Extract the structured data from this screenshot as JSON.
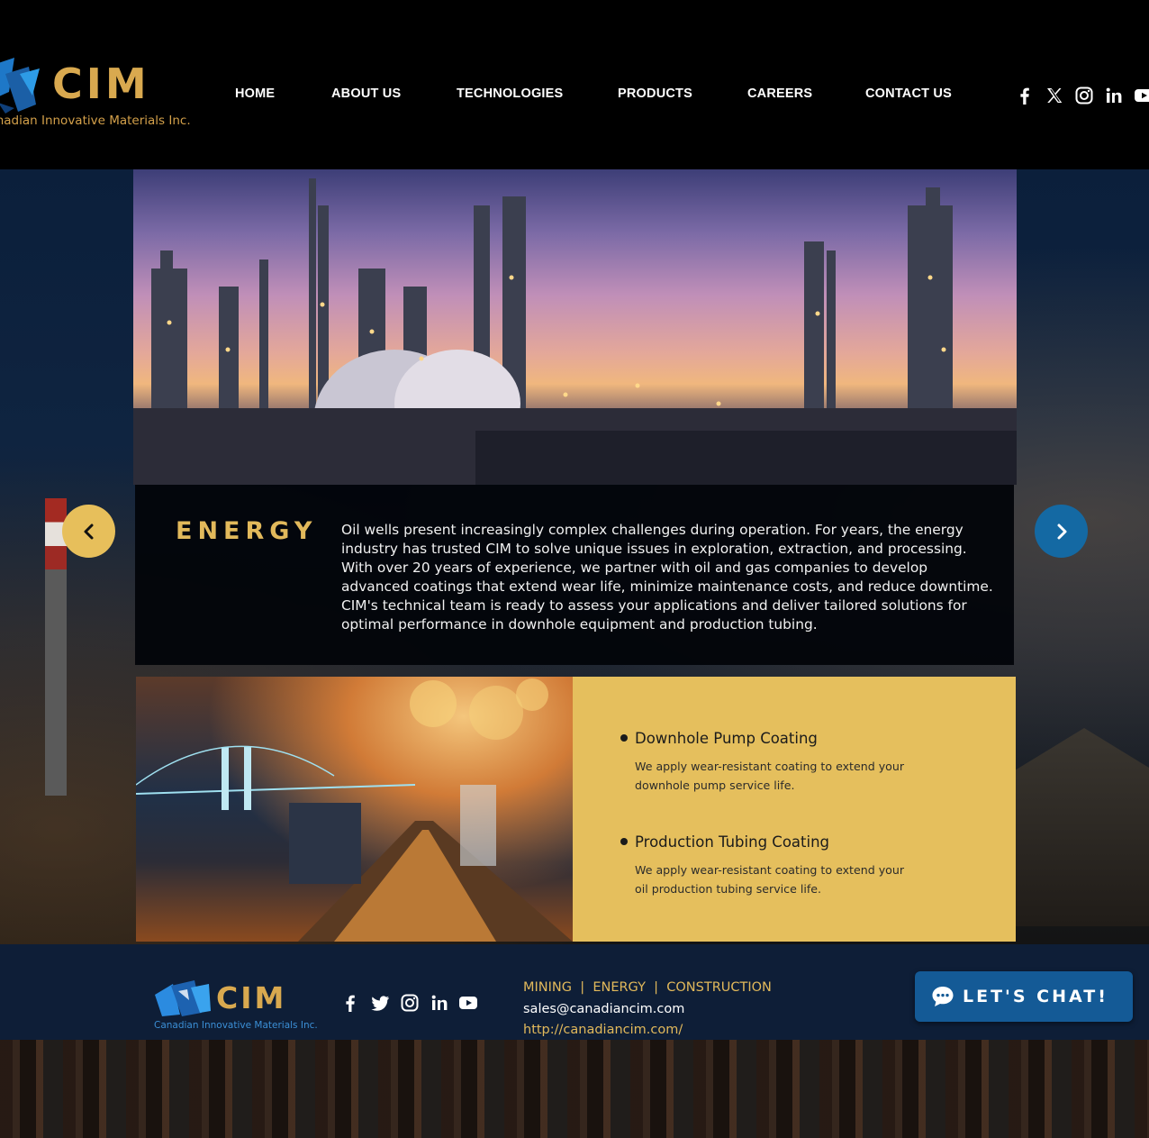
{
  "header": {
    "logo_word": "CIM",
    "logo_tagline": "Canadian Innovative Materials Inc.",
    "nav": [
      {
        "label": "HOME"
      },
      {
        "label": "ABOUT US"
      },
      {
        "label": "TECHNOLOGIES"
      },
      {
        "label": "PRODUCTS"
      },
      {
        "label": "CAREERS"
      },
      {
        "label": "CONTACT US"
      }
    ],
    "social_icons": [
      "facebook-icon",
      "x-icon",
      "instagram-icon",
      "linkedin-icon",
      "youtube-icon"
    ]
  },
  "hero": {
    "title": "ENERGY",
    "body": "Oil wells present increasingly complex challenges during operation. For years, the energy industry has trusted CIM to solve unique issues in exploration, extraction, and processing. With over 20 years of experience, we partner with oil and gas companies to develop advanced coatings that extend wear life, minimize maintenance costs, and reduce downtime. CIM's technical team is ready to assess your applications and deliver tailored solutions for optimal performance in downhole equipment and production tubing.",
    "prev_icon": "chevron-left-icon",
    "next_icon": "chevron-right-icon"
  },
  "products": [
    {
      "title": "Downhole Pump Coating",
      "desc": "We apply wear-resistant coating to extend your downhole pump service life."
    },
    {
      "title": "Production Tubing Coating",
      "desc": "We apply wear-resistant coating to extend your oil production tubing service life."
    }
  ],
  "footer": {
    "logo_word": "CIM",
    "logo_tagline": "Canadian Innovative Materials Inc.",
    "sectors": "MINING  |  ENERGY  |  CONSTRUCTION",
    "email": "sales@canadiancim.com",
    "url": "http://canadiancim.com/",
    "social_icons": [
      "facebook-icon",
      "twitter-icon",
      "instagram-icon",
      "linkedin-icon",
      "youtube-icon"
    ]
  },
  "chat": {
    "label": "LET'S CHAT!"
  },
  "colors": {
    "gold": "#e2b95b",
    "navy": "#0e1e37",
    "chat_blue": "#145a96",
    "arrow_blue": "#1469a3"
  }
}
